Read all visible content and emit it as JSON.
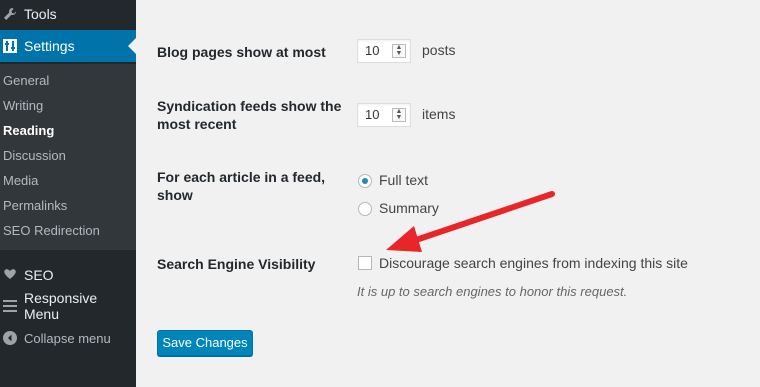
{
  "sidebar": {
    "tools": "Tools",
    "settings": "Settings",
    "submenu": [
      "General",
      "Writing",
      "Reading",
      "Discussion",
      "Media",
      "Permalinks",
      "SEO Redirection"
    ],
    "seo": "SEO",
    "responsive_menu": "Responsive Menu",
    "collapse": "Collapse menu"
  },
  "form": {
    "blog_pages_label": "Blog pages show at most",
    "blog_pages_value": "10",
    "blog_pages_unit": "posts",
    "syndication_label_1": "Syndication feeds show the",
    "syndication_label_2": "most recent",
    "syndication_value": "10",
    "syndication_unit": "items",
    "feed_label_1": "For each article in a feed,",
    "feed_label_2": "show",
    "feed_full_text": "Full text",
    "feed_summary": "Summary",
    "visibility_label": "Search Engine Visibility",
    "visibility_checkbox": "Discourage search engines from indexing this site",
    "visibility_desc": "It is up to search engines to honor this request.",
    "save_button": "Save Changes"
  },
  "colors": {
    "annotation_arrow": "#e8262a",
    "accent": "#0073aa"
  }
}
